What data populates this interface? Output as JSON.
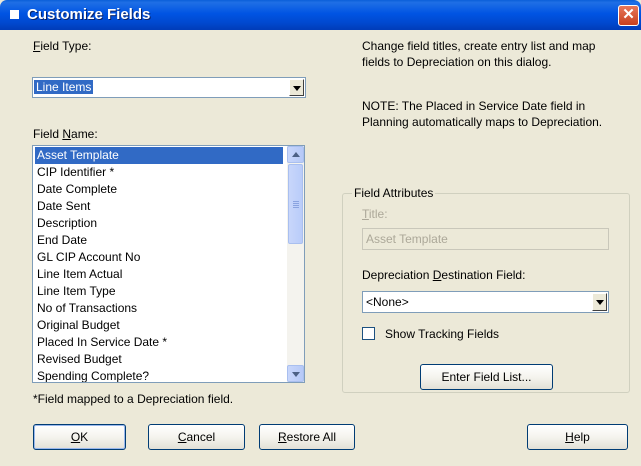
{
  "window": {
    "title": "Customize Fields",
    "close_glyph": "✕"
  },
  "field_type": {
    "label_accel": "F",
    "label_rest": "ield Type:",
    "value": "Line Items"
  },
  "info": {
    "line1": "Change field titles, create entry list and map",
    "line2": "fields to Depreciation on this dialog.",
    "note1": "NOTE: The Placed in Service Date field in",
    "note2": "Planning automatically maps to Depreciation."
  },
  "field_name": {
    "label_pre": "Field ",
    "label_accel": "N",
    "label_rest": "ame:",
    "items": [
      "Asset Template",
      "CIP Identifier *",
      "Date Complete",
      "Date Sent",
      "Description",
      "End Date",
      "GL CIP Account No",
      "Line Item Actual",
      "Line Item Type",
      "No of Transactions",
      "Original Budget",
      "Placed In Service Date *",
      "Revised Budget",
      "Spending Complete?"
    ],
    "selected_index": 0
  },
  "footnote": "*Field mapped to a Depreciation field.",
  "attributes": {
    "group_title": "Field Attributes",
    "title_label_accel": "T",
    "title_label_rest": "itle:",
    "title_value": "Asset Template",
    "dest_label_pre": "Depreciation ",
    "dest_label_accel": "D",
    "dest_label_rest": "estination Field:",
    "dest_value": "<None>",
    "show_tracking_label": "Show Tracking Fields",
    "show_tracking_checked": false,
    "enter_list_label": "Enter Field List..."
  },
  "buttons": {
    "ok_accel": "O",
    "ok_rest": "K",
    "cancel_accel": "C",
    "cancel_rest": "ancel",
    "restore_accel": "R",
    "restore_rest": "estore All",
    "help_accel": "H",
    "help_rest": "elp"
  },
  "colors": {
    "titlebar": "#0054E3",
    "selection": "#316AC5",
    "dialog_bg": "#ECE9D8"
  }
}
